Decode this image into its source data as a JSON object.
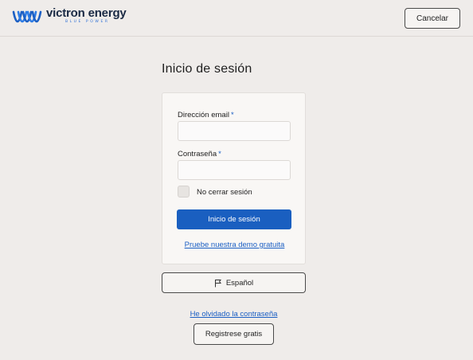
{
  "header": {
    "brand_name": "victron energy",
    "brand_tagline": "BLUE POWER",
    "cancel_label": "Cancelar"
  },
  "login": {
    "title": "Inicio de sesión",
    "email_label": "Dirección email",
    "email_required": "*",
    "email_value": "",
    "password_label": "Contraseña",
    "password_required": "*",
    "password_value": "",
    "remember_label": "No cerrar sesión",
    "remember_checked": false,
    "submit_label": "Inicio de sesión",
    "demo_link": "Pruebe nuestra demo gratuita"
  },
  "language": {
    "icon": "flag-icon",
    "selected": "Español"
  },
  "footer": {
    "forgot_link": "He olvidado la contraseña",
    "register_label": "Registrese gratis"
  },
  "colors": {
    "background": "#efecea",
    "primary": "#1a5fc0",
    "link": "#1b5fc4",
    "brand_dark": "#1a2a44"
  }
}
